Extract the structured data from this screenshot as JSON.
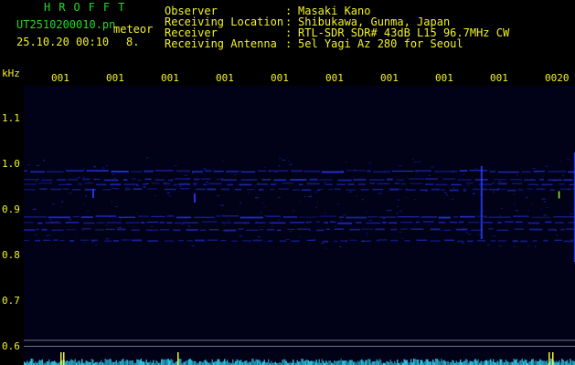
{
  "header": {
    "brand": "HROFFT",
    "filename": "UT2510200010.pn",
    "meteor_label": "meteor",
    "datetime": "25.10.20 00:10",
    "count": "8.",
    "fields": [
      {
        "label": "Observer",
        "sep": ":",
        "value": "Masaki Kano"
      },
      {
        "label": "Receiving Location",
        "sep": ":",
        "value": "Shibukawa, Gunma, Japan"
      },
      {
        "label": "Receiver",
        "sep": ":",
        "value": "RTL-SDR SDR# 43dB L15 96.7MHz CW"
      },
      {
        "label": "Receiving Antenna",
        "sep": ":",
        "value": "5el Yagi Az 280 for Seoul"
      }
    ]
  },
  "axis": {
    "unit": "kHz",
    "y_ticks": [
      "1.1",
      "1.0",
      "0.9",
      "0.8",
      "0.7",
      "0.6"
    ],
    "x_ticks": [
      "001",
      "001",
      "001",
      "001",
      "001",
      "001",
      "001",
      "001",
      "001",
      "0020"
    ]
  },
  "colors": {
    "background": "#000000",
    "plot_background": "#010118",
    "label_green": "#22d822",
    "label_yellow": "#f2f22a",
    "signal_blue": "#2a3cff",
    "noise_cyan": "#2ec8e8"
  },
  "chart_data": {
    "type": "heatmap",
    "title": "",
    "ylabel": "kHz",
    "ylim": [
      0.58,
      1.17
    ],
    "traces": [
      {
        "freq_khz": 0.99,
        "intensity": 0.85
      },
      {
        "freq_khz": 0.972,
        "intensity": 0.55
      },
      {
        "freq_khz": 0.962,
        "intensity": 0.45
      },
      {
        "freq_khz": 0.95,
        "intensity": 0.35
      },
      {
        "freq_khz": 0.89,
        "intensity": 0.85
      },
      {
        "freq_khz": 0.878,
        "intensity": 0.55
      },
      {
        "freq_khz": 0.862,
        "intensity": 0.4
      },
      {
        "freq_khz": 0.838,
        "intensity": 0.3
      }
    ],
    "bursts": [
      {
        "x_index": 0.7,
        "f_from": 0.93,
        "f_to": 0.95
      },
      {
        "x_index": 2.55,
        "f_from": 0.92,
        "f_to": 0.94
      },
      {
        "x_index": 7.78,
        "f_from": 0.84,
        "f_to": 1.0
      },
      {
        "x_index": 9.48,
        "f_from": 0.79,
        "f_to": 1.03
      }
    ],
    "reference_lines_khz": [
      0.618,
      0.605
    ]
  }
}
